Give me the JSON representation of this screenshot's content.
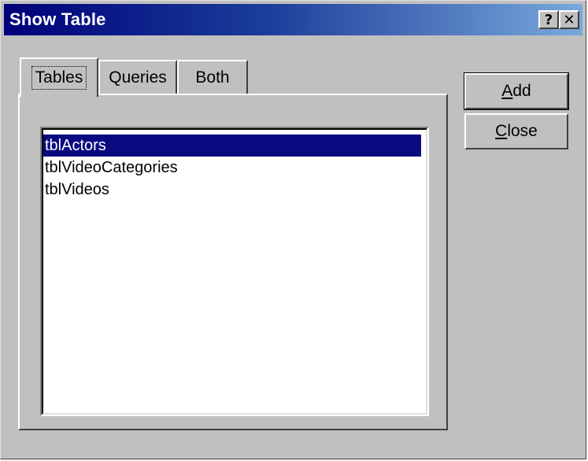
{
  "window": {
    "title": "Show Table",
    "help_glyph": "?",
    "close_glyph": "✕"
  },
  "tabs": [
    {
      "label": "Tables",
      "active": true
    },
    {
      "label": "Queries",
      "active": false
    },
    {
      "label": "Both",
      "active": false
    }
  ],
  "list": {
    "items": [
      {
        "label": "tblActors",
        "selected": true
      },
      {
        "label": "tblVideoCategories",
        "selected": false
      },
      {
        "label": "tblVideos",
        "selected": false
      }
    ]
  },
  "buttons": {
    "add": {
      "mnemonic": "A",
      "rest": "dd"
    },
    "close": {
      "mnemonic": "C",
      "rest": "lose"
    }
  },
  "colors": {
    "title_start": "#00007a",
    "title_end": "#7aa8dc",
    "selection": "#0a0a80",
    "face": "#c0c0c0"
  }
}
